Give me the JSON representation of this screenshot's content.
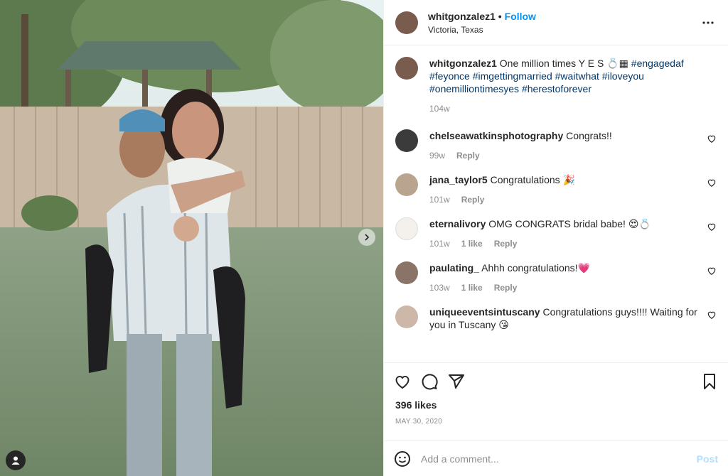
{
  "post": {
    "username": "whitgonzalez1",
    "follow_label": "Follow",
    "dot": "•",
    "location": "Victoria, Texas",
    "caption_text": "One million times Y E S 💍▦",
    "hashtags": "#engagedaf #feyonce #imgettingmarried #waitwhat #iloveyou #onemilliontimesyes #herestoforever",
    "caption_age": "104w",
    "likes": "396 likes",
    "date": "MAY 30, 2020"
  },
  "comments": [
    {
      "user": "chelseawatkinsphotography",
      "text": "Congrats!!",
      "age": "99w",
      "likes": "",
      "reply": "Reply"
    },
    {
      "user": "jana_taylor5",
      "text": "Congratulations 🎉",
      "age": "101w",
      "likes": "",
      "reply": "Reply"
    },
    {
      "user": "eternalivory",
      "text": "OMG CONGRATS bridal babe! 😍💍",
      "age": "101w",
      "likes": "1 like",
      "reply": "Reply"
    },
    {
      "user": "paulating_",
      "text": "Ahhh congratulations!💗",
      "age": "103w",
      "likes": "1 like",
      "reply": "Reply"
    },
    {
      "user": "uniqueeventsintuscany",
      "text": "Congratulations guys!!!! Waiting for you in Tuscany 😘",
      "age": "",
      "likes": "",
      "reply": ""
    }
  ],
  "composer": {
    "placeholder": "Add a comment...",
    "post_label": "Post"
  },
  "icons": {
    "more": "more-options-icon",
    "heart": "heart-icon",
    "comment": "comment-icon",
    "share": "share-icon",
    "bookmark": "bookmark-icon",
    "emoji": "emoji-icon",
    "next": "chevron-right-icon",
    "user_tag": "user-icon"
  },
  "colors": {
    "accent": "#0095f6",
    "hashtag": "#00376b",
    "muted": "#8e8e8e",
    "post_disabled": "#b2dffc"
  }
}
